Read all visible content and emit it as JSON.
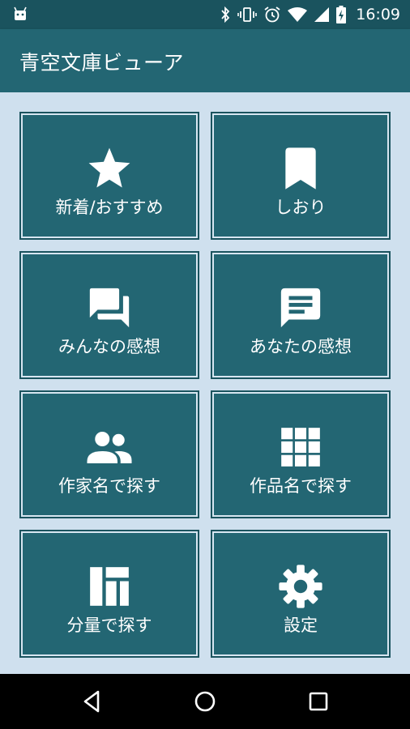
{
  "status_bar": {
    "time": "16:09",
    "icons": [
      "android-icon",
      "bluetooth-icon",
      "vibrate-icon",
      "alarm-icon",
      "wifi-icon",
      "signal-icon",
      "battery-charging-icon"
    ]
  },
  "app_bar": {
    "title": "青空文庫ビューア"
  },
  "menu": {
    "tiles": [
      {
        "label": "新着/おすすめ",
        "icon": "star-icon"
      },
      {
        "label": "しおり",
        "icon": "bookmark-icon"
      },
      {
        "label": "みんなの感想",
        "icon": "forum-icon"
      },
      {
        "label": "あなたの感想",
        "icon": "comment-icon"
      },
      {
        "label": "作家名で探す",
        "icon": "people-icon"
      },
      {
        "label": "作品名で探す",
        "icon": "grid-icon"
      },
      {
        "label": "分量で探す",
        "icon": "dashboard-icon"
      },
      {
        "label": "設定",
        "icon": "gear-icon"
      }
    ]
  },
  "nav_bar": {
    "icons": [
      "back-icon",
      "home-icon",
      "recents-icon"
    ]
  },
  "colors": {
    "status_bar": "#1a535e",
    "app_bar": "#236673",
    "tile": "#236673",
    "background": "#cfe0ee",
    "nav_bar": "#000000"
  }
}
